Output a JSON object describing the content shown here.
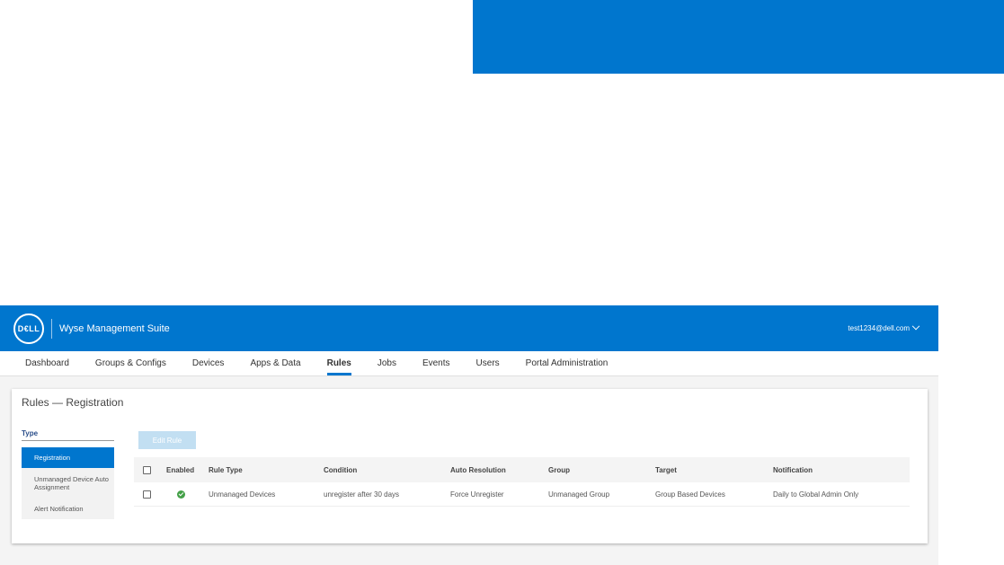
{
  "app": {
    "logo_text": "D€LL",
    "title": "Wyse Management Suite",
    "user": "test1234@dell.com"
  },
  "nav": {
    "items": [
      "Dashboard",
      "Groups & Configs",
      "Devices",
      "Apps & Data",
      "Rules",
      "Jobs",
      "Events",
      "Users",
      "Portal Administration"
    ],
    "active": "Rules"
  },
  "page": {
    "title": "Rules — Registration",
    "type_label": "Type",
    "types": [
      "Registration",
      "Unmanaged Device Auto Assignment",
      "Alert Notification"
    ],
    "edit_button": "Edit Rule"
  },
  "table": {
    "headers": [
      "Enabled",
      "Rule Type",
      "Condition",
      "Auto Resolution",
      "Group",
      "Target",
      "Notification"
    ],
    "rows": [
      {
        "enabled": true,
        "rule_type": "Unmanaged Devices",
        "condition": "unregister after 30 days",
        "auto_resolution": "Force Unregister",
        "group": "Unmanaged Group",
        "target": "Group Based Devices",
        "notification": "Daily to Global Admin Only"
      }
    ]
  },
  "colors": {
    "brand_blue": "#0076ce",
    "enabled_green": "#43a047",
    "disabled_button": "#c2dff2"
  }
}
